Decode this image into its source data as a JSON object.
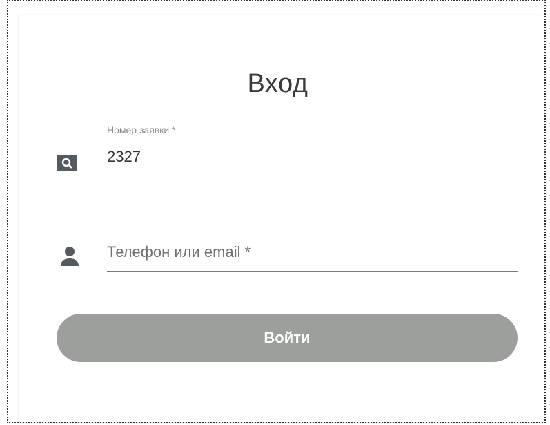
{
  "form": {
    "title": "Вход",
    "order_field": {
      "label": "Номер заявки *",
      "value": "2327",
      "icon": "search-icon"
    },
    "contact_field": {
      "placeholder": "Телефон или email *",
      "icon": "user-icon"
    },
    "submit_label": "Войти"
  },
  "colors": {
    "button": "#9d9f9d",
    "icon": "#555960",
    "text": "#333333"
  }
}
